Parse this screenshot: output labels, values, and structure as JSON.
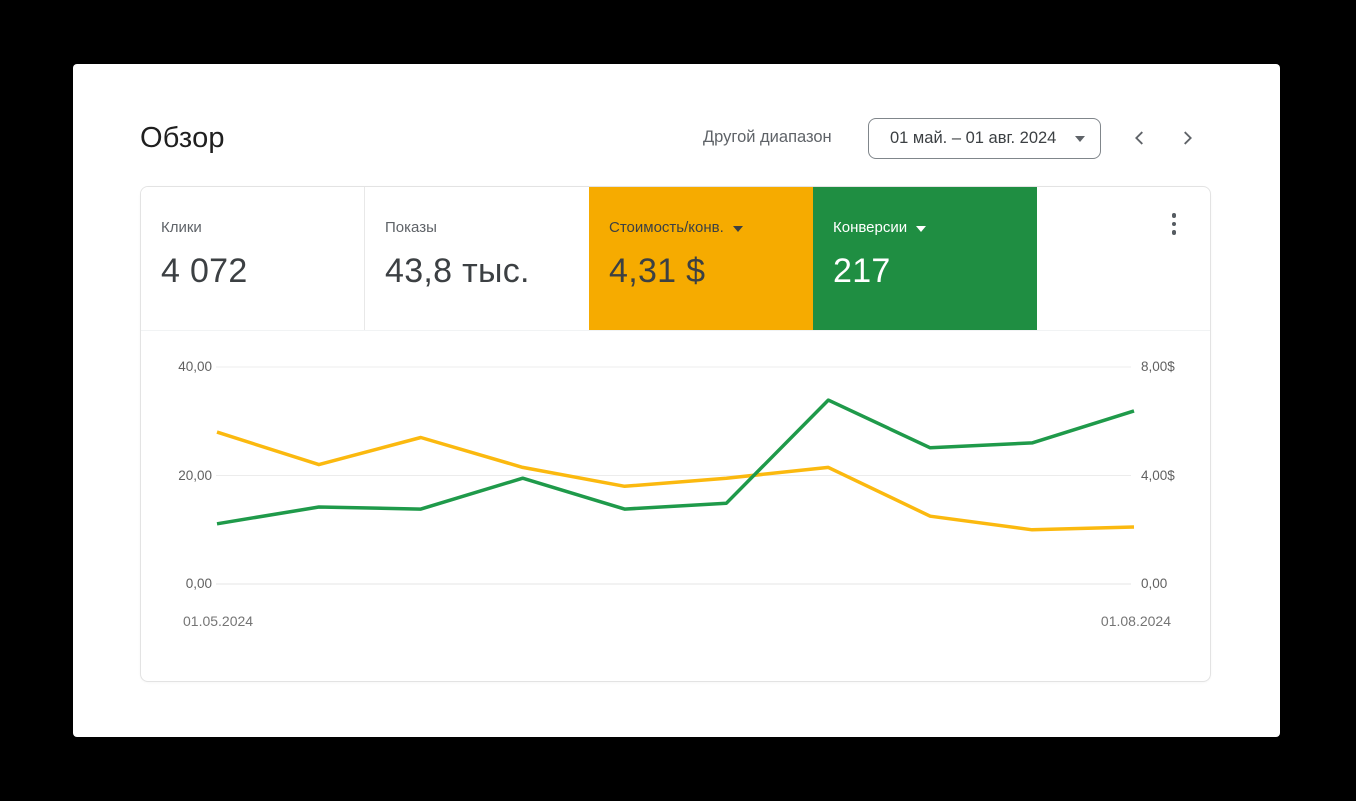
{
  "header": {
    "title": "Обзор",
    "range_link": "Другой диапазон",
    "date_range": "01 май. – 01 авг. 2024"
  },
  "scorecards": [
    {
      "label": "Клики",
      "value": "4 072",
      "bg": "#ffffff"
    },
    {
      "label": "Показы",
      "value": "43,8 тыс.",
      "bg": "#ffffff"
    },
    {
      "label": "Стоимость/конв.",
      "value": "4,31 $",
      "bg": "#F6AB00"
    },
    {
      "label": "Конверсии",
      "value": "217",
      "bg": "#1F8E42"
    }
  ],
  "chart_data": {
    "type": "line",
    "title": "",
    "x_labels": [
      "01.05.2024",
      "01.08.2024"
    ],
    "left_axis": {
      "min": 0,
      "max": 40,
      "ticks": [
        "40,00",
        "20,00",
        "0,00"
      ]
    },
    "right_axis": {
      "min": 0,
      "max": 8,
      "ticks": [
        "8,00$",
        "4,00$",
        "0,00"
      ]
    },
    "grid": true,
    "legend": "none",
    "series": [
      {
        "name": "Конверсии",
        "axis": "left",
        "color": "#1F9A4A",
        "values": [
          11.1,
          14.2,
          13.8,
          19.5,
          13.8,
          14.9,
          33.9,
          25.1,
          26.0,
          31.9
        ]
      },
      {
        "name": "Стоимость/конв.",
        "axis": "right",
        "color": "#FBB90F",
        "values": [
          5.6,
          4.4,
          5.4,
          4.3,
          3.6,
          3.9,
          4.3,
          2.5,
          2.0,
          2.1
        ]
      }
    ]
  }
}
